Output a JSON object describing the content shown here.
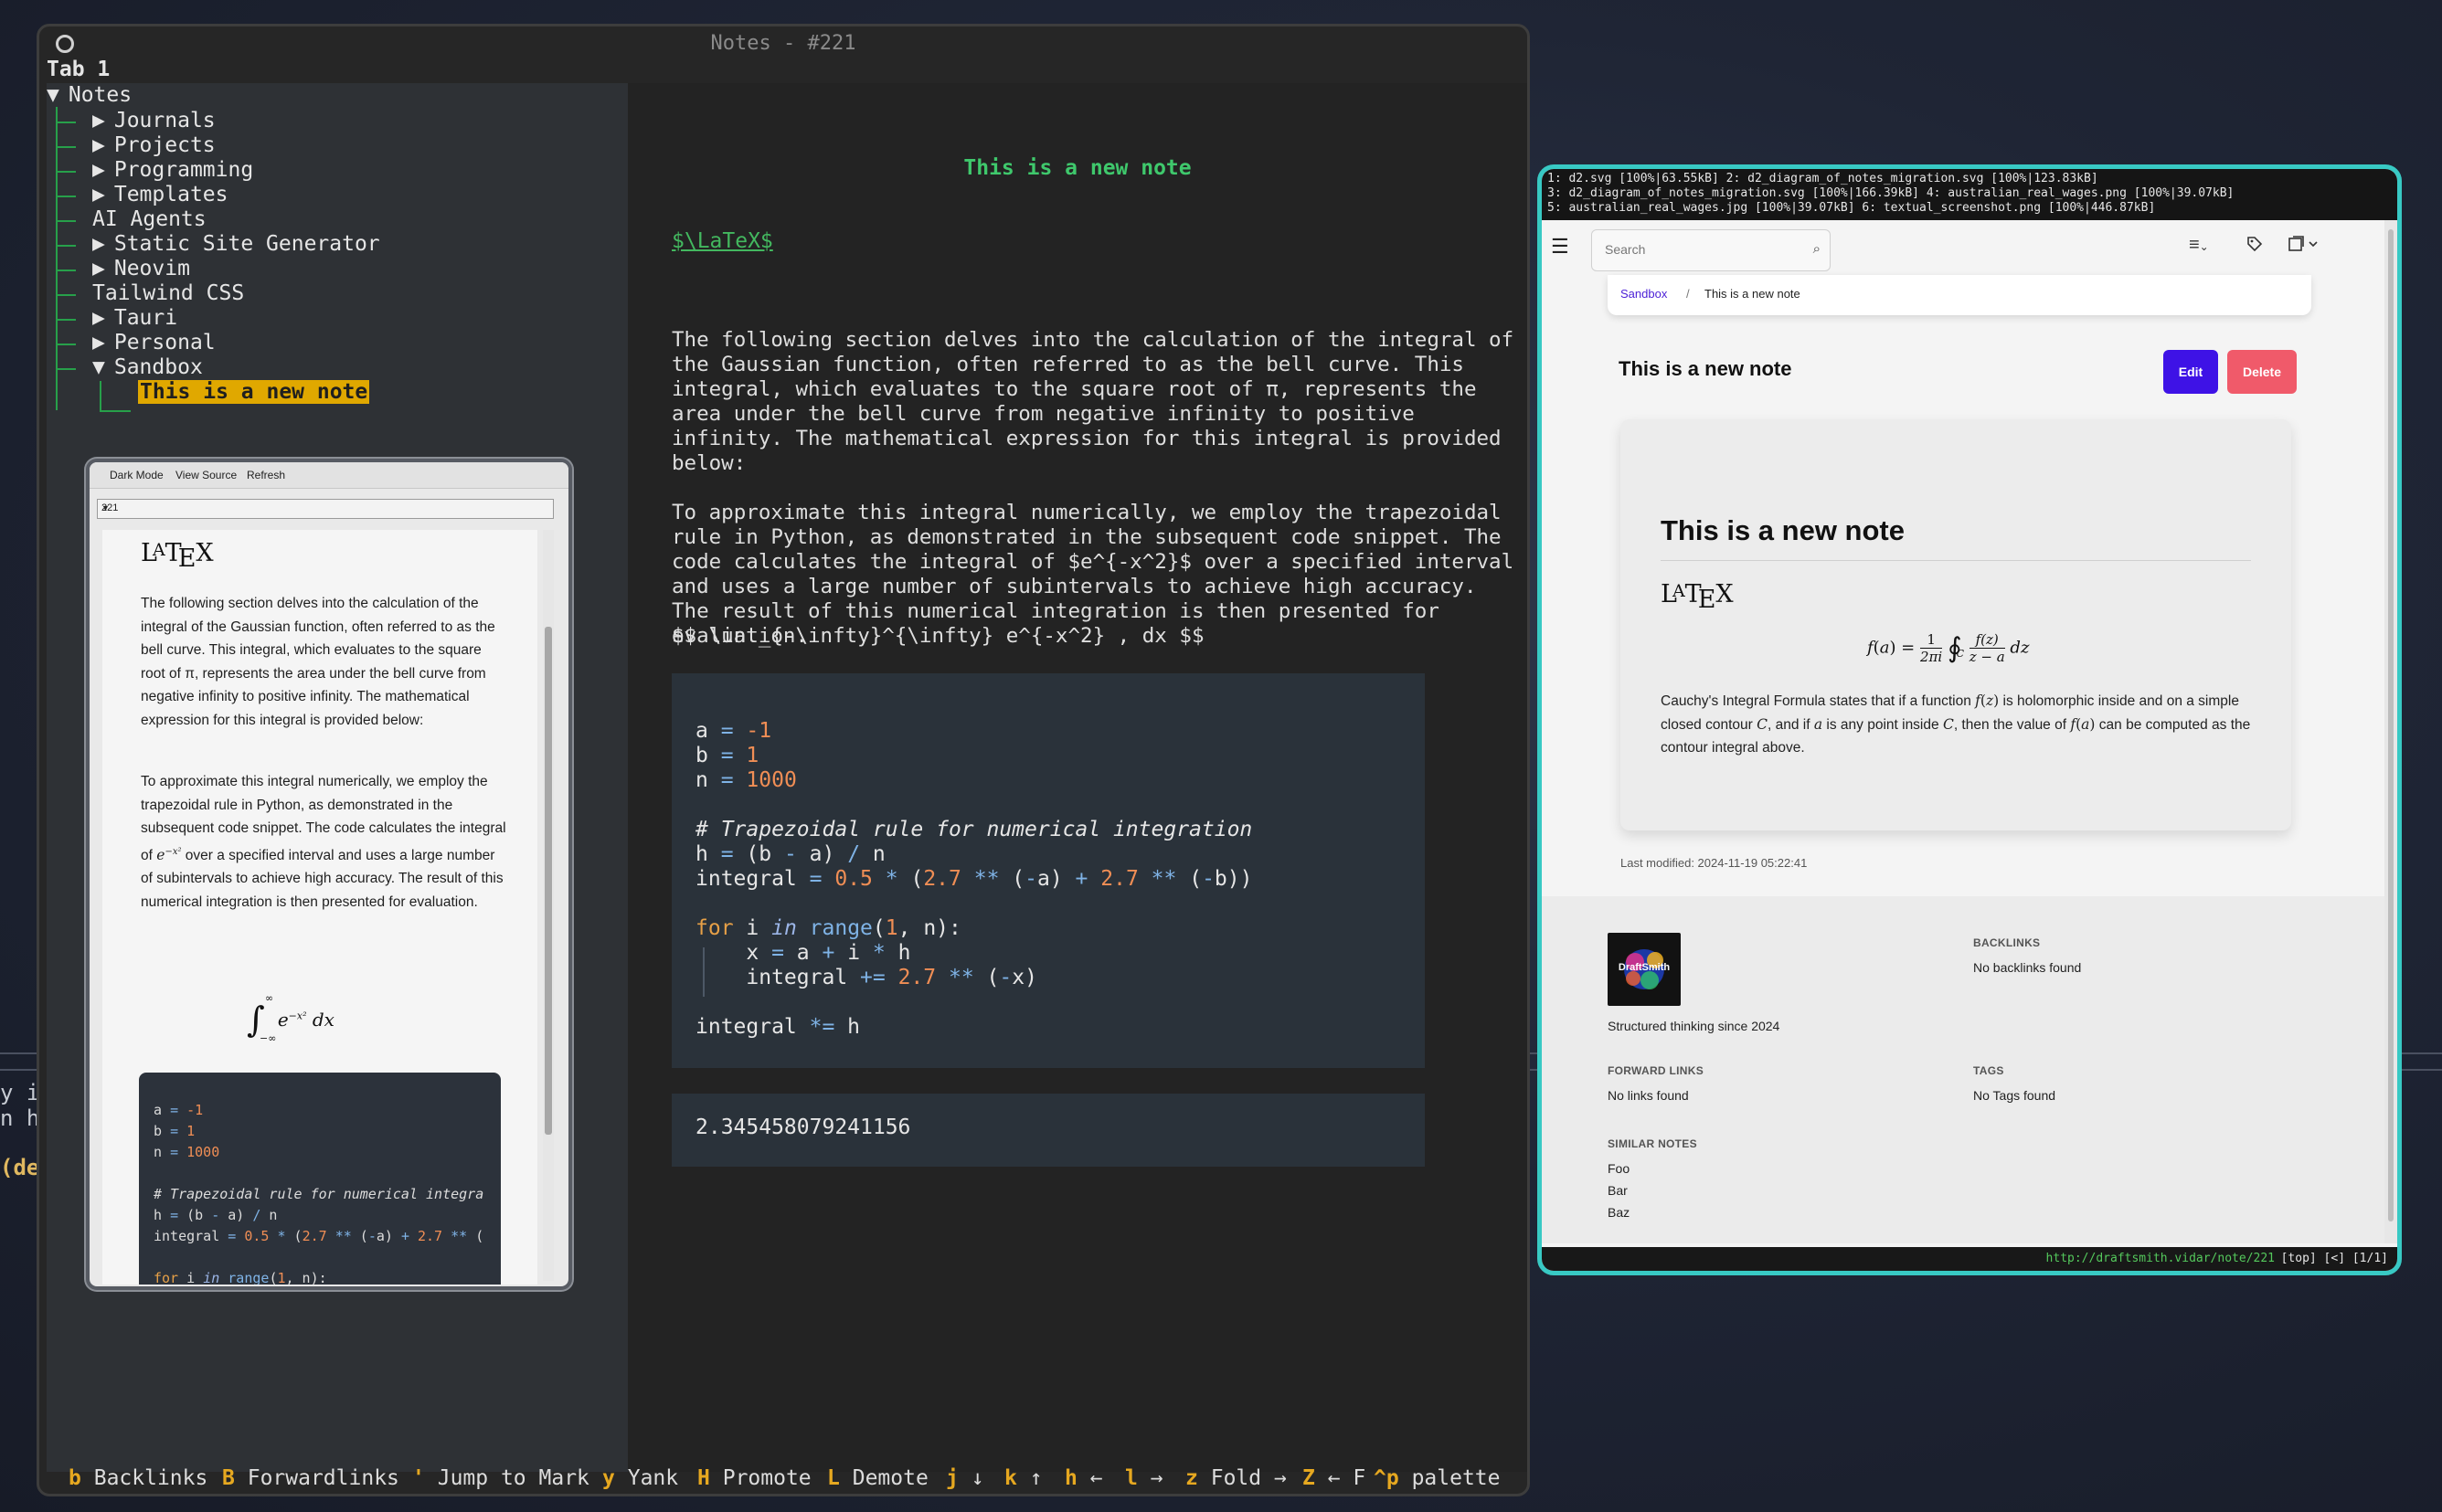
{
  "background_terminal": {
    "fragments": [
      "y in",
      "n ho",
      "(def"
    ]
  },
  "terminal": {
    "title": "Notes - #221",
    "tab_label": "Tab 1",
    "tree": {
      "root": "Notes",
      "items": [
        "Journals",
        "Projects",
        "Programming",
        "Templates",
        "AI Agents",
        "Static Site Generator",
        "Neovim",
        "Tailwind CSS",
        "Tauri",
        "Personal",
        "Sandbox"
      ],
      "selected_child": "This is a new note"
    },
    "note": {
      "heading": "This is a new note",
      "latex_link": "$\\LaTeX$",
      "para1": [
        "The following section delves into the calculation of the integral of",
        "the Gaussian function, often referred to as the bell curve. This",
        "integral, which evaluates to the square root of π, represents the",
        "area under the bell curve from negative infinity to positive",
        "infinity. The mathematical expression for this integral is provided",
        "below:"
      ],
      "para2": [
        "To approximate this integral numerically, we employ the trapezoidal",
        "rule in Python, as demonstrated in the subsequent code snippet. The",
        "code calculates the integral of $e^{-x^2}$ over a specified interval",
        "and uses a large number of subintervals to achieve high accuracy.",
        "The result of this numerical integration is then presented for",
        "evaluation."
      ],
      "math_source": "$$ \\int_{-\\infty}^{\\infty} e^{-x^2} , dx $$",
      "output": "2.345458079241156"
    },
    "statusbar": [
      {
        "key": "b",
        "label": "Backlinks"
      },
      {
        "key": "B",
        "label": "Forwardlinks"
      },
      {
        "key": "'",
        "label": "Jump to Mark"
      },
      {
        "key": "y",
        "label": "Yank"
      },
      {
        "key": "H",
        "label": "Promote"
      },
      {
        "key": "L",
        "label": "Demote"
      },
      {
        "key": "j",
        "label": "↓"
      },
      {
        "key": "k",
        "label": "↑"
      },
      {
        "key": "h",
        "label": "←"
      },
      {
        "key": "l",
        "label": "→"
      },
      {
        "key": "z",
        "label": "Fold →"
      },
      {
        "key": "Z",
        "label": "← F"
      },
      {
        "key": "^p",
        "label": "palette"
      }
    ]
  },
  "preview": {
    "menu": [
      "Dark Mode",
      "View Source",
      "Refresh"
    ],
    "select_value": "221",
    "latex_logo": "LaTeX",
    "para1": "The following section delves into the calculation of the integral of the Gaussian function, often referred to as the bell curve. This integral, which evaluates to the square root of π, represents the area under the bell curve from negative infinity to positive infinity. The mathematical expression for this integral is provided below:",
    "para2_a": "To approximate this integral numerically, we employ the trapezoidal rule in Python, as demonstrated in the subsequent code snippet. The code calculates the",
    "para2_b": "integral of",
    "para2_c": "over a specified interval and uses a large number of subintervals to achieve high accuracy. The result of this numerical integration is then presented for evaluation."
  },
  "browser": {
    "tabs_line1": "1: d2.svg [100%|63.55kB] 2: d2_diagram_of_notes_migration.svg [100%|123.83kB]",
    "tabs_line2": "3: d2_diagram_of_notes_migration.svg [100%|166.39kB] 4: australian_real_wages.png [100%|39.07kB]",
    "tabs_line3": "5: australian_real_wages.jpg [100%|39.07kB] 6: textual_screenshot.png [100%|446.87kB]",
    "search_placeholder": "Search",
    "breadcrumb": [
      "Sandbox",
      "/",
      "This is a new note"
    ],
    "page_title": "This is a new note",
    "edit_label": "Edit",
    "delete_label": "Delete",
    "card": {
      "title": "This is a new note",
      "latex_logo": "LaTeX",
      "paragraph_parts": [
        "Cauchy's Integral Formula states that if a function",
        "is holomorphic inside and on a simple closed contour",
        ", and if",
        "is any point inside",
        ", then the value of",
        "can be computed as the contour integral above."
      ]
    },
    "last_modified": "Last modified: 2024-11-19 05:22:41",
    "footer": {
      "logo_text": "DraftSmith",
      "tagline": "Structured thinking since 2024",
      "backlinks_head": "BACKLINKS",
      "backlinks_text": "No backlinks found",
      "forward_head": "FORWARD LINKS",
      "forward_text": "No links found",
      "tags_head": "TAGS",
      "tags_text": "No Tags found",
      "similar_head": "SIMILAR NOTES",
      "similar": [
        "Foo",
        "Bar",
        "Baz"
      ]
    },
    "status_url": "http://draftsmith.vidar/note/221",
    "status_rest": "[top] [<] [1/1]"
  }
}
